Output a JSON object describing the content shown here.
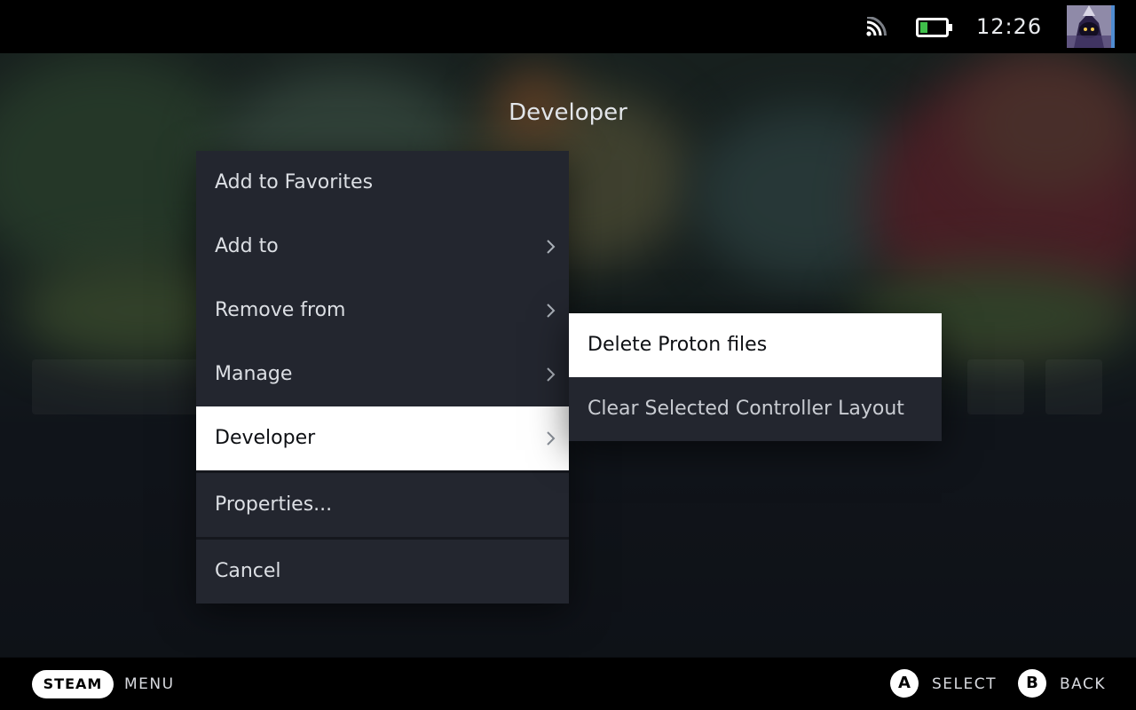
{
  "status_bar": {
    "time": "12:26",
    "wifi_icon": "wifi-icon",
    "battery_icon": "battery-icon",
    "battery_level": 0.25,
    "battery_color": "#3fbf4a"
  },
  "dialog": {
    "title": "Developer"
  },
  "context_menu": {
    "items": [
      {
        "label": "Add to Favorites",
        "has_submenu": false
      },
      {
        "label": "Add to",
        "has_submenu": true
      },
      {
        "label": "Remove from",
        "has_submenu": true
      },
      {
        "label": "Manage",
        "has_submenu": true
      },
      {
        "label": "Developer",
        "has_submenu": true,
        "selected": true
      },
      {
        "label": "Properties...",
        "has_submenu": false
      },
      {
        "label": "Cancel",
        "has_submenu": false
      }
    ]
  },
  "submenu": {
    "items": [
      {
        "label": "Delete Proton files",
        "selected": true
      },
      {
        "label": "Clear Selected Controller Layout"
      }
    ]
  },
  "bottom_bar": {
    "steam_label": "STEAM",
    "menu_label": "MENU",
    "a_glyph": "A",
    "select_label": "SELECT",
    "b_glyph": "B",
    "back_label": "BACK"
  },
  "colors": {
    "menu_bg": "#23262f",
    "selected_bg": "#ffffff",
    "bar_bg": "#000000"
  }
}
